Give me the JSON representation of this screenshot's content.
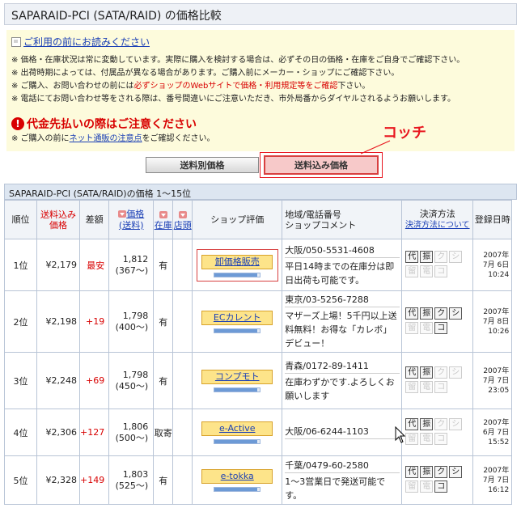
{
  "page_title": "SAPARAID-PCI (SATA/RAID) の価格比較",
  "notice": {
    "head_link": "ご利用の前にお読みください",
    "lines": [
      "※ 価格・在庫状況は常に変動しています。実際に購入を検討する場合は、必ずその日の価格・在庫をご自身でご確認下さい。",
      "※ 出荷時期によっては、付属品が異なる場合があります。ご購入前にメーカー・ショップにご確認下さい。",
      "※ ご購入、お問い合わせの前には",
      "必ずショップのWebサイトで価格・利用規定等をご確認",
      "下さい。",
      "※ 電話にてお問い合わせ等をされる際は、番号間違いにご注意いただき、市外局番からダイヤルされるようお願いします。"
    ],
    "warn_title": "代金先払いの際はご注意ください",
    "warn_pre": "※ ご購入の前に",
    "warn_link": "ネット通販の注意点",
    "warn_post": "をご確認ください。"
  },
  "annotation": "コッチ",
  "tabs": {
    "shipping_separate": "送料別価格",
    "shipping_included": "送料込み価格"
  },
  "table": {
    "caption": "SAPARAID-PCI (SATA/RAID)の価格 1～15位",
    "headers": {
      "rank": "順位",
      "total_price": "送料込み価格",
      "diff": "差額",
      "price": "価格",
      "shipping": "(送料)",
      "stock": "在庫",
      "store": "店頭",
      "shop_rating": "ショップ評価",
      "region_phone": "地域/電話番号",
      "shop_comment": "ショップコメント",
      "payment": "決済方法",
      "payment_link": "決済方法について",
      "registered": "登録日時"
    },
    "rows": [
      {
        "rank": "1位",
        "total": "¥2,179",
        "diff": "最安",
        "price": "1,812",
        "ship": "(367～)",
        "stock": "有",
        "store": "",
        "shop": "卸価格販売",
        "rating": 0.95,
        "tel": "大阪/050-5531-4608",
        "comment": "平日14時までの在庫分は即日出荷も可能です。",
        "pay": [
          [
            "代",
            1
          ],
          [
            "振",
            1
          ],
          [
            "ク",
            0
          ],
          [
            "シ",
            0
          ],
          [
            "留",
            0
          ],
          [
            "電",
            0
          ],
          [
            "コ",
            0
          ]
        ],
        "date": "2007年",
        "md": "7月 6日",
        "time": "10:24"
      },
      {
        "rank": "2位",
        "total": "¥2,198",
        "diff": "+19",
        "price": "1,798",
        "ship": "(400～)",
        "stock": "有",
        "store": "",
        "shop": "ECカレント",
        "rating": 0.95,
        "tel": "東京/03-5256-7288",
        "comment": "マザーズ上場！5千円以上送料無料！お得な「カレボ」デビュー！",
        "pay": [
          [
            "代",
            1
          ],
          [
            "振",
            1
          ],
          [
            "ク",
            1
          ],
          [
            "シ",
            1
          ],
          [
            "留",
            0
          ],
          [
            "電",
            0
          ],
          [
            "コ",
            1
          ]
        ],
        "date": "2007年",
        "md": "7月 8日",
        "time": "10:26"
      },
      {
        "rank": "3位",
        "total": "¥2,248",
        "diff": "+69",
        "price": "1,798",
        "ship": "(450～)",
        "stock": "有",
        "store": "",
        "shop": "コンプモト",
        "rating": 0.95,
        "tel": "青森/0172-89-1411",
        "comment": "在庫わずかです.よろしくお願いします",
        "pay": [
          [
            "代",
            1
          ],
          [
            "振",
            1
          ],
          [
            "ク",
            0
          ],
          [
            "シ",
            0
          ],
          [
            "留",
            0
          ],
          [
            "電",
            0
          ],
          [
            "コ",
            0
          ]
        ],
        "date": "2007年",
        "md": "7月 7日",
        "time": "23:05"
      },
      {
        "rank": "4位",
        "total": "¥2,306",
        "diff": "+127",
        "price": "1,806",
        "ship": "(500～)",
        "stock": "取寄",
        "store": "",
        "shop": "e-Active",
        "rating": 0.95,
        "tel": "大阪/06-6244-1103",
        "comment": "",
        "pay": [
          [
            "代",
            1
          ],
          [
            "振",
            1
          ],
          [
            "ク",
            0
          ],
          [
            "シ",
            0
          ],
          [
            "留",
            0
          ],
          [
            "電",
            0
          ],
          [
            "コ",
            0
          ]
        ],
        "date": "2007年",
        "md": "6月 7日",
        "time": "15:52"
      },
      {
        "rank": "5位",
        "total": "¥2,328",
        "diff": "+149",
        "price": "1,803",
        "ship": "(525～)",
        "stock": "有",
        "store": "",
        "shop": "e-tokka",
        "rating": 0.95,
        "tel": "千葉/0479-60-2580",
        "comment": "1～3営業日で発送可能です。",
        "pay": [
          [
            "代",
            1
          ],
          [
            "振",
            1
          ],
          [
            "ク",
            1
          ],
          [
            "シ",
            1
          ],
          [
            "留",
            0
          ],
          [
            "電",
            0
          ],
          [
            "コ",
            1
          ]
        ],
        "date": "2007年",
        "md": "7月 7日",
        "time": "16:12"
      }
    ]
  }
}
